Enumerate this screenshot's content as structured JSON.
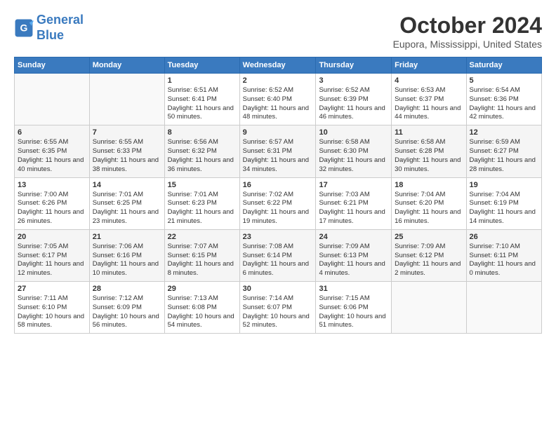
{
  "logo": {
    "line1": "General",
    "line2": "Blue"
  },
  "title": "October 2024",
  "location": "Eupora, Mississippi, United States",
  "weekdays": [
    "Sunday",
    "Monday",
    "Tuesday",
    "Wednesday",
    "Thursday",
    "Friday",
    "Saturday"
  ],
  "weeks": [
    [
      {
        "day": "",
        "info": ""
      },
      {
        "day": "",
        "info": ""
      },
      {
        "day": "1",
        "info": "Sunrise: 6:51 AM\nSunset: 6:41 PM\nDaylight: 11 hours and 50 minutes."
      },
      {
        "day": "2",
        "info": "Sunrise: 6:52 AM\nSunset: 6:40 PM\nDaylight: 11 hours and 48 minutes."
      },
      {
        "day": "3",
        "info": "Sunrise: 6:52 AM\nSunset: 6:39 PM\nDaylight: 11 hours and 46 minutes."
      },
      {
        "day": "4",
        "info": "Sunrise: 6:53 AM\nSunset: 6:37 PM\nDaylight: 11 hours and 44 minutes."
      },
      {
        "day": "5",
        "info": "Sunrise: 6:54 AM\nSunset: 6:36 PM\nDaylight: 11 hours and 42 minutes."
      }
    ],
    [
      {
        "day": "6",
        "info": "Sunrise: 6:55 AM\nSunset: 6:35 PM\nDaylight: 11 hours and 40 minutes."
      },
      {
        "day": "7",
        "info": "Sunrise: 6:55 AM\nSunset: 6:33 PM\nDaylight: 11 hours and 38 minutes."
      },
      {
        "day": "8",
        "info": "Sunrise: 6:56 AM\nSunset: 6:32 PM\nDaylight: 11 hours and 36 minutes."
      },
      {
        "day": "9",
        "info": "Sunrise: 6:57 AM\nSunset: 6:31 PM\nDaylight: 11 hours and 34 minutes."
      },
      {
        "day": "10",
        "info": "Sunrise: 6:58 AM\nSunset: 6:30 PM\nDaylight: 11 hours and 32 minutes."
      },
      {
        "day": "11",
        "info": "Sunrise: 6:58 AM\nSunset: 6:28 PM\nDaylight: 11 hours and 30 minutes."
      },
      {
        "day": "12",
        "info": "Sunrise: 6:59 AM\nSunset: 6:27 PM\nDaylight: 11 hours and 28 minutes."
      }
    ],
    [
      {
        "day": "13",
        "info": "Sunrise: 7:00 AM\nSunset: 6:26 PM\nDaylight: 11 hours and 26 minutes."
      },
      {
        "day": "14",
        "info": "Sunrise: 7:01 AM\nSunset: 6:25 PM\nDaylight: 11 hours and 23 minutes."
      },
      {
        "day": "15",
        "info": "Sunrise: 7:01 AM\nSunset: 6:23 PM\nDaylight: 11 hours and 21 minutes."
      },
      {
        "day": "16",
        "info": "Sunrise: 7:02 AM\nSunset: 6:22 PM\nDaylight: 11 hours and 19 minutes."
      },
      {
        "day": "17",
        "info": "Sunrise: 7:03 AM\nSunset: 6:21 PM\nDaylight: 11 hours and 17 minutes."
      },
      {
        "day": "18",
        "info": "Sunrise: 7:04 AM\nSunset: 6:20 PM\nDaylight: 11 hours and 16 minutes."
      },
      {
        "day": "19",
        "info": "Sunrise: 7:04 AM\nSunset: 6:19 PM\nDaylight: 11 hours and 14 minutes."
      }
    ],
    [
      {
        "day": "20",
        "info": "Sunrise: 7:05 AM\nSunset: 6:17 PM\nDaylight: 11 hours and 12 minutes."
      },
      {
        "day": "21",
        "info": "Sunrise: 7:06 AM\nSunset: 6:16 PM\nDaylight: 11 hours and 10 minutes."
      },
      {
        "day": "22",
        "info": "Sunrise: 7:07 AM\nSunset: 6:15 PM\nDaylight: 11 hours and 8 minutes."
      },
      {
        "day": "23",
        "info": "Sunrise: 7:08 AM\nSunset: 6:14 PM\nDaylight: 11 hours and 6 minutes."
      },
      {
        "day": "24",
        "info": "Sunrise: 7:09 AM\nSunset: 6:13 PM\nDaylight: 11 hours and 4 minutes."
      },
      {
        "day": "25",
        "info": "Sunrise: 7:09 AM\nSunset: 6:12 PM\nDaylight: 11 hours and 2 minutes."
      },
      {
        "day": "26",
        "info": "Sunrise: 7:10 AM\nSunset: 6:11 PM\nDaylight: 11 hours and 0 minutes."
      }
    ],
    [
      {
        "day": "27",
        "info": "Sunrise: 7:11 AM\nSunset: 6:10 PM\nDaylight: 10 hours and 58 minutes."
      },
      {
        "day": "28",
        "info": "Sunrise: 7:12 AM\nSunset: 6:09 PM\nDaylight: 10 hours and 56 minutes."
      },
      {
        "day": "29",
        "info": "Sunrise: 7:13 AM\nSunset: 6:08 PM\nDaylight: 10 hours and 54 minutes."
      },
      {
        "day": "30",
        "info": "Sunrise: 7:14 AM\nSunset: 6:07 PM\nDaylight: 10 hours and 52 minutes."
      },
      {
        "day": "31",
        "info": "Sunrise: 7:15 AM\nSunset: 6:06 PM\nDaylight: 10 hours and 51 minutes."
      },
      {
        "day": "",
        "info": ""
      },
      {
        "day": "",
        "info": ""
      }
    ]
  ]
}
